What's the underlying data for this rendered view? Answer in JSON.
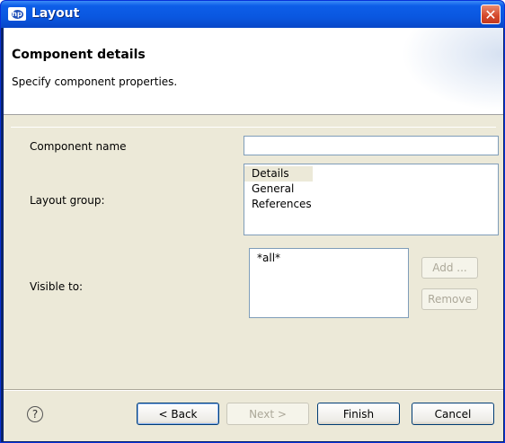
{
  "window": {
    "title": "Layout",
    "close_glyph": "✕",
    "icon": "app-logo-icon"
  },
  "banner": {
    "title": "Component details",
    "subtitle": "Specify component properties."
  },
  "form": {
    "component_name_label": "Component name",
    "component_name_value": "",
    "layout_group_label": "Layout group:",
    "layout_group_items": [
      "Details",
      "General",
      "References"
    ],
    "layout_group_selected": "Details",
    "visible_to_label": "Visible to:",
    "visible_to_items": [
      "*all*"
    ],
    "add_button": "Add ...",
    "remove_button": "Remove"
  },
  "footer": {
    "help_glyph": "?",
    "back_button": "< Back",
    "next_button": "Next >",
    "finish_button": "Finish",
    "cancel_button": "Cancel"
  },
  "colors": {
    "titlebar": "#0a57e0",
    "dialog_bg": "#ece9d8",
    "close_button": "#d4472a"
  }
}
